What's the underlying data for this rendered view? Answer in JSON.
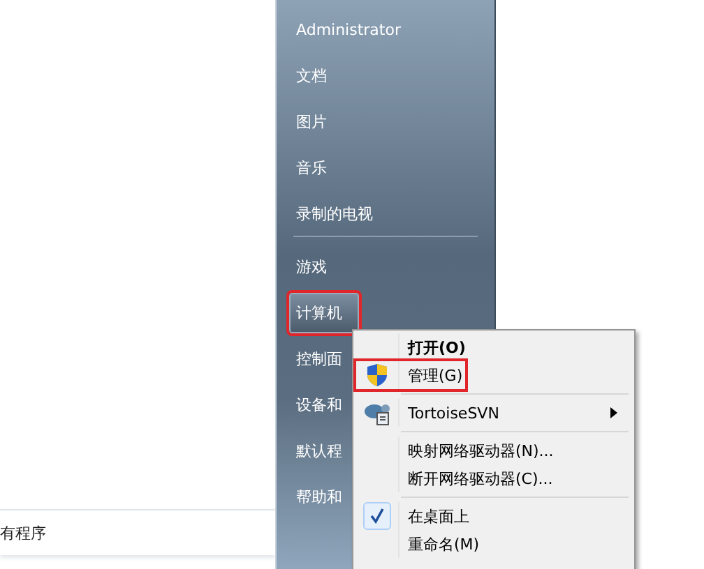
{
  "all_programs": {
    "label": "有程序"
  },
  "right_pane": {
    "items": [
      {
        "label": "Administrator",
        "selected": false,
        "marked": false,
        "separator_after": false
      },
      {
        "label": "文档",
        "selected": false,
        "marked": false,
        "separator_after": false
      },
      {
        "label": "图片",
        "selected": false,
        "marked": false,
        "separator_after": false
      },
      {
        "label": "音乐",
        "selected": false,
        "marked": false,
        "separator_after": false
      },
      {
        "label": "录制的电视",
        "selected": false,
        "marked": false,
        "separator_after": true
      },
      {
        "label": "游戏",
        "selected": false,
        "marked": false,
        "separator_after": false
      },
      {
        "label": "计算机",
        "selected": true,
        "marked": true,
        "separator_after": false
      },
      {
        "label": "控制面",
        "selected": false,
        "marked": false,
        "separator_after": false
      },
      {
        "label": "设备和",
        "selected": false,
        "marked": false,
        "separator_after": false
      },
      {
        "label": "默认程",
        "selected": false,
        "marked": false,
        "separator_after": false
      },
      {
        "label": "帮助和",
        "selected": false,
        "marked": false,
        "separator_after": false
      }
    ]
  },
  "context_menu": {
    "items": [
      {
        "kind": "default",
        "label": "打开(O)",
        "marked": false
      },
      {
        "kind": "admin",
        "label": "管理(G)",
        "marked": true
      },
      {
        "kind": "separator"
      },
      {
        "kind": "submenu",
        "label": "TortoiseSVN",
        "marked": false
      },
      {
        "kind": "separator"
      },
      {
        "kind": "plain",
        "label": "映射网络驱动器(N)...",
        "marked": false
      },
      {
        "kind": "plain",
        "label": "断开网络驱动器(C)...",
        "marked": false
      },
      {
        "kind": "separator"
      },
      {
        "kind": "check",
        "label": "在桌面上",
        "marked": false
      },
      {
        "kind": "plain",
        "label": "重命名(M)",
        "marked": false
      }
    ]
  }
}
